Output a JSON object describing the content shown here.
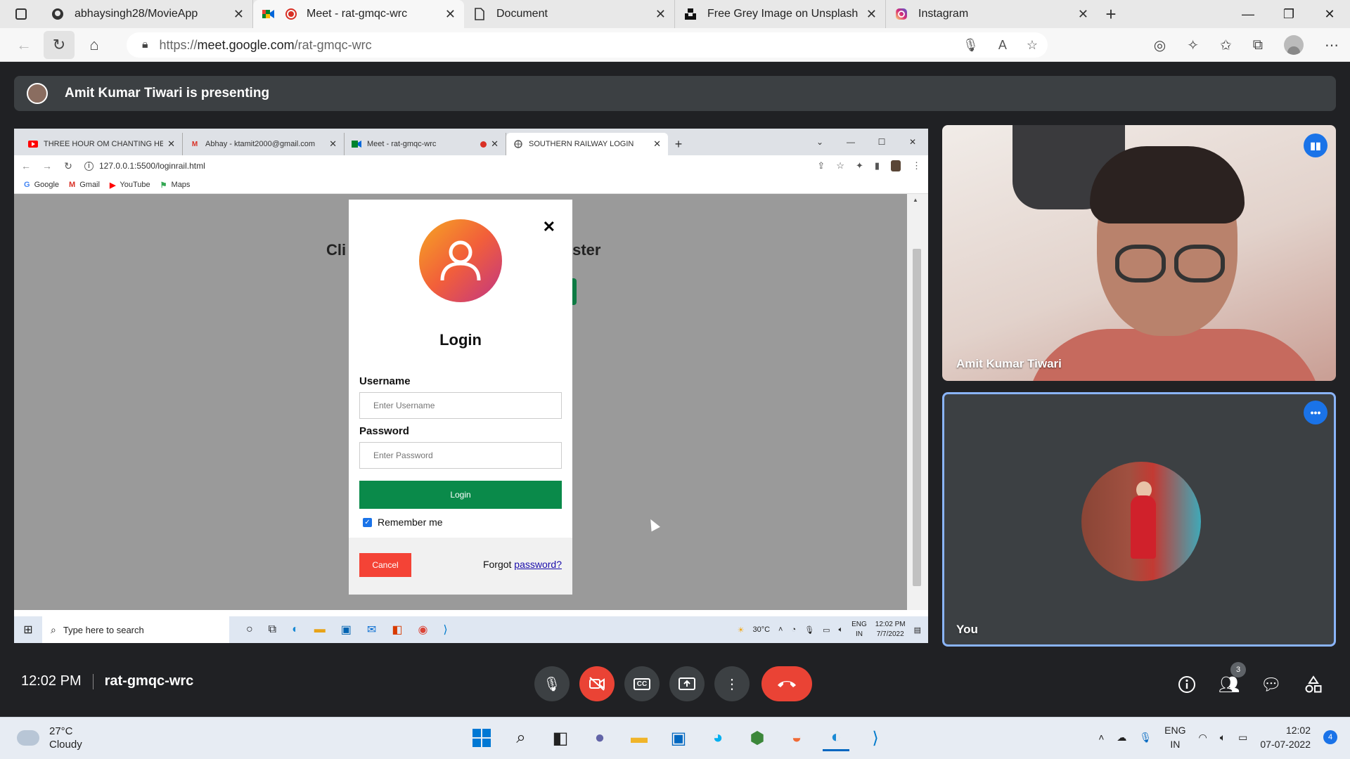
{
  "edge": {
    "tabs": [
      {
        "title": "abhaysingh28/MovieApp",
        "icon": "github-icon"
      },
      {
        "title": "Meet - rat-gmqc-wrc",
        "icon": "meet-icon",
        "active": true
      },
      {
        "title": "Document",
        "icon": "document-icon"
      },
      {
        "title": "Free Grey Image on Unsplash",
        "icon": "unsplash-icon"
      },
      {
        "title": "Instagram",
        "icon": "instagram-icon"
      }
    ],
    "address": {
      "prefix": "https://",
      "host": "meet.google.com",
      "path": "/rat-gmqc-wrc"
    }
  },
  "meet": {
    "presenting_banner": "Amit Kumar Tiwari is presenting",
    "time": "12:02 PM",
    "meeting_code": "rat-gmqc-wrc",
    "participants_count": "3",
    "tiles": [
      {
        "name": "Amit Kumar Tiwari"
      },
      {
        "name": "You"
      }
    ],
    "colors": {
      "accent": "#1a73e8",
      "danger": "#ea4335",
      "surface": "#3c4043"
    }
  },
  "shared_screen": {
    "tabs": [
      {
        "title": "THREE HOUR OM CHANTING HE",
        "icon": "youtube-icon"
      },
      {
        "title": "Abhay - ktamit2000@gmail.com",
        "icon": "gmail-icon"
      },
      {
        "title": "Meet - rat-gmqc-wrc",
        "icon": "meet-icon"
      },
      {
        "title": "SOUTHERN RAILWAY LOGIN",
        "icon": "globe-icon",
        "active": true
      }
    ],
    "url": "127.0.0.1:5500/loginrail.html",
    "bookmarks": [
      "Google",
      "Gmail",
      "YouTube",
      "Maps"
    ],
    "page": {
      "bg_title_left": "Cli",
      "bg_title_right": "ister"
    },
    "login_modal": {
      "title": "Login",
      "username_label": "Username",
      "username_placeholder": "Enter Username",
      "password_label": "Password",
      "password_placeholder": "Enter Password",
      "login_button": "Login",
      "remember_label": "Remember me",
      "remember_checked": true,
      "cancel_button": "Cancel",
      "forgot_prefix": "Forgot ",
      "forgot_link": "password?"
    },
    "taskbar": {
      "search_placeholder": "Type here to search",
      "temperature": "30°C",
      "lang_top": "ENG",
      "lang_bottom": "IN",
      "time": "12:02 PM",
      "date": "7/7/2022"
    }
  },
  "taskbar": {
    "weather_temp": "27°C",
    "weather_desc": "Cloudy",
    "lang_top": "ENG",
    "lang_bottom": "IN",
    "time": "12:02",
    "date": "07-07-2022",
    "notifications": "4"
  }
}
